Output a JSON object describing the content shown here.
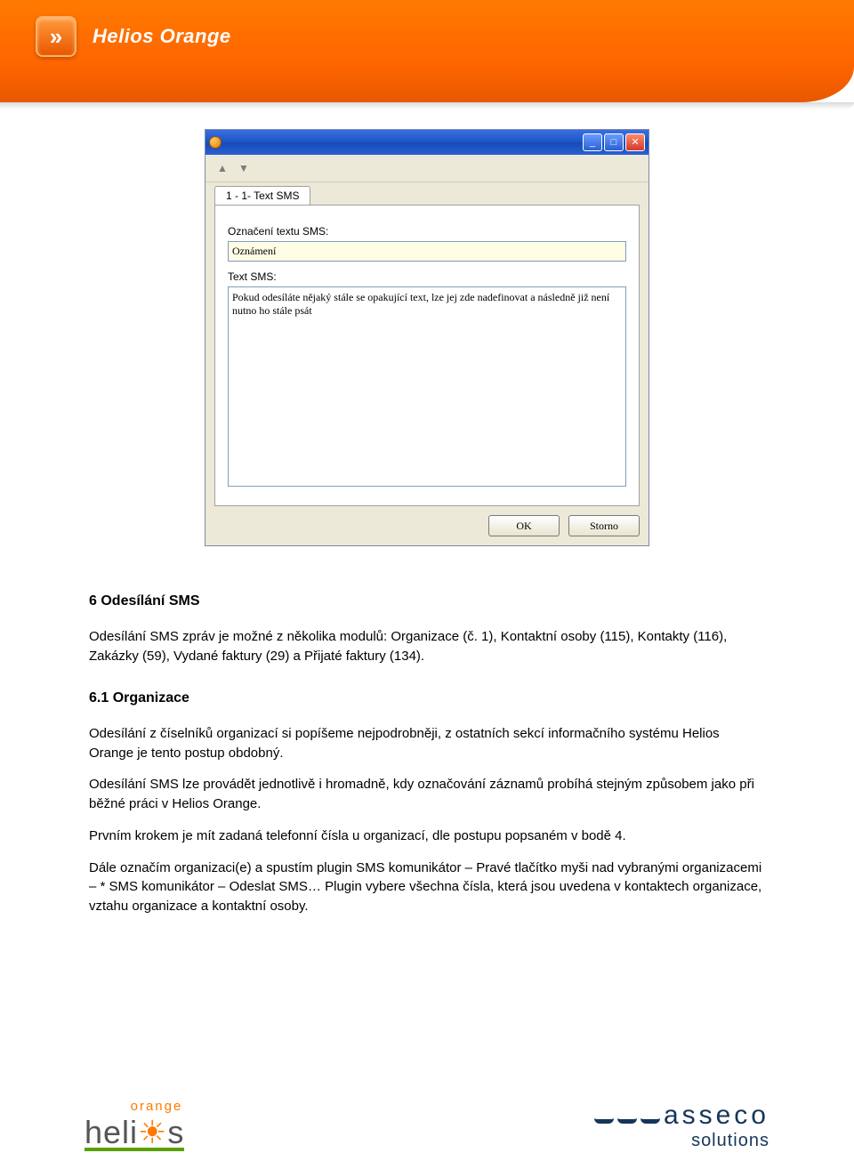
{
  "header": {
    "brand": "Helios Orange"
  },
  "dialog": {
    "tab_label": "1 - 1- Text SMS",
    "label1": "Označení textu SMS:",
    "input1_value": "Oznámení",
    "label2": "Text SMS:",
    "textarea_value": "Pokud odesíláte nějaký stále se opakující text, lze jej zde nadefinovat a následně již není nutno ho stále psát",
    "ok": "OK",
    "cancel": "Storno"
  },
  "doc": {
    "h1": "6  Odesílání SMS",
    "p1": "Odesílání SMS zpráv je možné z několika modulů: Organizace (č. 1), Kontaktní osoby (115), Kontakty (116), Zakázky (59), Vydané faktury (29) a Přijaté faktury (134).",
    "h2": "6.1   Organizace",
    "p2": "Odesílání z číselníků organizací si popíšeme nejpodrobněji, z ostatních sekcí informačního systému Helios Orange je tento postup obdobný.",
    "p3": "Odesílání SMS lze provádět jednotlivě i hromadně, kdy označování záznamů probíhá stejným způsobem jako při běžné práci v Helios Orange.",
    "p4": "Prvním krokem je mít zadaná telefonní čísla u organizací, dle postupu popsaném v bodě 4.",
    "p5": "Dále označím organizaci(e) a spustím plugin SMS komunikátor – Pravé tlačítko myši nad vybranými organizacemi – * SMS komunikátor – Odeslat SMS… Plugin vybere všechna čísla, která jsou uvedena v kontaktech organizace, vztahu organizace a kontaktní osoby."
  },
  "footer": {
    "helios_top": "orange",
    "helios_bottom_pre": "heli",
    "helios_bottom_post": "s",
    "asseco_name": "asseco",
    "asseco_sub": "solutions"
  }
}
